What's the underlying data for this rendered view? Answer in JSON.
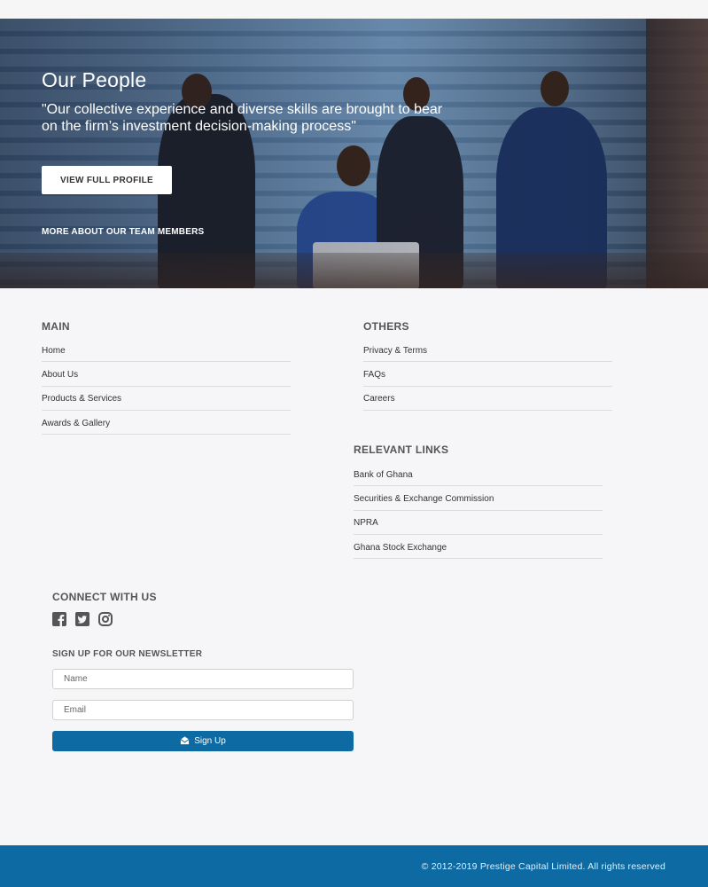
{
  "hero": {
    "title": "Our People",
    "quote": "\"Our collective experience and diverse skills are brought to bear on the firm’s investment decision-making process\"",
    "profile_button": "VIEW FULL PROFILE",
    "more_link": "MORE ABOUT OUR TEAM MEMBERS"
  },
  "main": {
    "title": "MAIN",
    "links": [
      "Home",
      "About Us",
      "Products & Services",
      "Awards & Gallery"
    ]
  },
  "others": {
    "title": "OTHERS",
    "links": [
      "Privacy & Terms",
      "FAQs",
      "Careers"
    ]
  },
  "relevant": {
    "title": "RELEVANT LINKS",
    "links": [
      "Bank of Ghana",
      "Securities & Exchange Commission",
      "NPRA",
      "Ghana Stock Exchange"
    ]
  },
  "connect": {
    "title": "CONNECT WITH US",
    "icons": [
      "facebook-icon",
      "twitter-icon",
      "instagram-icon"
    ]
  },
  "newsletter": {
    "title": "SIGN UP FOR OUR NEWSLETTER",
    "name_placeholder": "Name",
    "email_placeholder": "Email",
    "signup_label": "Sign Up"
  },
  "footer": {
    "copyright": "© 2012-2019 Prestige Capital Limited. All rights reserved"
  },
  "colors": {
    "brand_blue": "#0d6aa3",
    "page_bg": "#f6f5f7"
  }
}
